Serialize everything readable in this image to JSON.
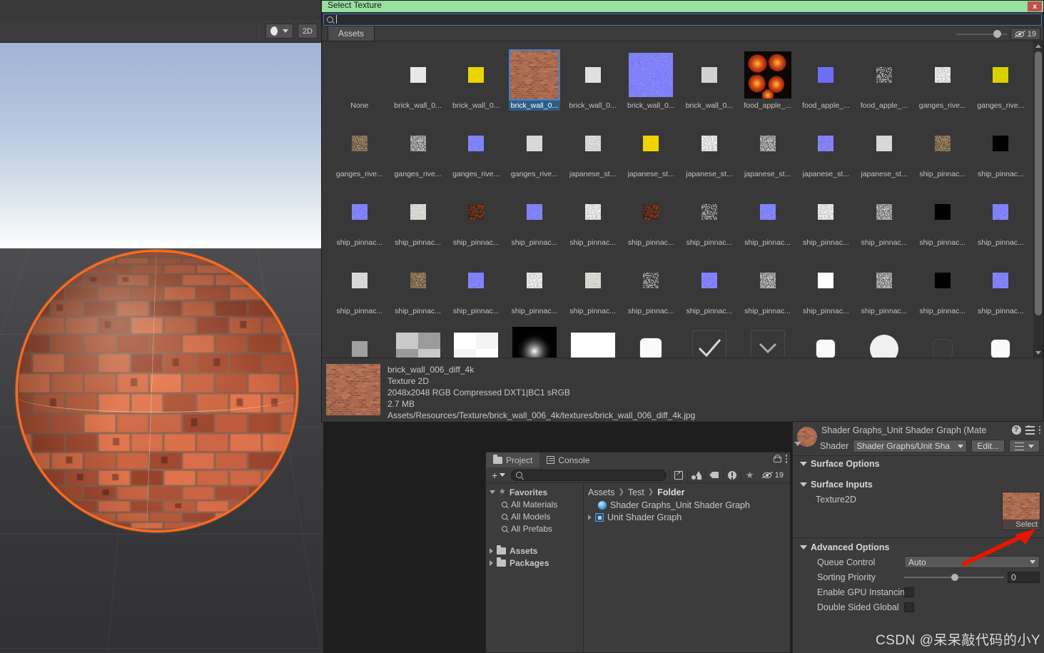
{
  "scene_view": {
    "toolbar": {
      "lighting_icon": "lit-sphere-icon",
      "lighting_dropdown_icon": "chevron-down-icon",
      "twod_label": "2D"
    },
    "selection_outline_color": "#ff6d1f",
    "object": "brick-textured-sphere"
  },
  "select_texture_window": {
    "title": "Select Texture",
    "close_label": "x",
    "search": {
      "value": "",
      "placeholder": "",
      "icon": "search-icon"
    },
    "tab": "Assets",
    "zoom_slider_value": 72,
    "hidden_count": "19",
    "hidden_icon": "eye-off-icon",
    "grid": [
      {
        "label": "None",
        "kind": "none"
      },
      {
        "label": "brick_wall_0...",
        "kind": "flat",
        "color": "#e8e8e8",
        "size": 22
      },
      {
        "label": "brick_wall_0...",
        "kind": "flat",
        "color": "#e8d600",
        "size": 22
      },
      {
        "label": "brick_wall_0...",
        "kind": "brick",
        "size": 68,
        "selected": true
      },
      {
        "label": "brick_wall_0...",
        "kind": "flat",
        "color": "#e0e0e0",
        "size": 22
      },
      {
        "label": "brick_wall_0...",
        "kind": "normal",
        "size": 62
      },
      {
        "label": "brick_wall_0...",
        "kind": "flat",
        "color": "#d2d2d2",
        "size": 22
      },
      {
        "label": "food_apple_...",
        "kind": "apple",
        "size": 66
      },
      {
        "label": "food_apple_...",
        "kind": "flat",
        "color": "#6e6ef5",
        "size": 22
      },
      {
        "label": "food_apple_...",
        "kind": "noise-dark",
        "size": 22
      },
      {
        "label": "ganges_rive...",
        "kind": "noise-light",
        "size": 22
      },
      {
        "label": "ganges_rive...",
        "kind": "flat",
        "color": "#d8d200",
        "size": 22
      },
      {
        "label": "ganges_rive...",
        "kind": "dirt",
        "size": 22
      },
      {
        "label": "ganges_rive...",
        "kind": "gravel",
        "size": 22
      },
      {
        "label": "ganges_rive...",
        "kind": "normal",
        "size": 22
      },
      {
        "label": "ganges_rive...",
        "kind": "flat",
        "color": "#d8d8d8",
        "size": 22
      },
      {
        "label": "japanese_st...",
        "kind": "stonewall",
        "size": 22
      },
      {
        "label": "japanese_st...",
        "kind": "flat",
        "color": "#f0d400",
        "size": 22
      },
      {
        "label": "japanese_st...",
        "kind": "noise-light",
        "size": 22
      },
      {
        "label": "japanese_st...",
        "kind": "gravel",
        "size": 22
      },
      {
        "label": "japanese_st...",
        "kind": "normal",
        "size": 22
      },
      {
        "label": "japanese_st...",
        "kind": "flat",
        "color": "#d8d8d8",
        "size": 22
      },
      {
        "label": "ship_pinnac...",
        "kind": "dirt",
        "size": 22
      },
      {
        "label": "ship_pinnac...",
        "kind": "flat",
        "color": "#000000",
        "size": 22
      },
      {
        "label": "ship_pinnac...",
        "kind": "normal",
        "size": 22
      },
      {
        "label": "ship_pinnac...",
        "kind": "stonewall",
        "size": 22
      },
      {
        "label": "ship_pinnac...",
        "kind": "rust",
        "size": 22
      },
      {
        "label": "ship_pinnac...",
        "kind": "normal",
        "size": 22
      },
      {
        "label": "ship_pinnac...",
        "kind": "noise-light",
        "size": 22
      },
      {
        "label": "ship_pinnac...",
        "kind": "rust",
        "size": 22
      },
      {
        "label": "ship_pinnac...",
        "kind": "noise-dark",
        "size": 22
      },
      {
        "label": "ship_pinnac...",
        "kind": "normal",
        "size": 22
      },
      {
        "label": "ship_pinnac...",
        "kind": "noise-light",
        "size": 22
      },
      {
        "label": "ship_pinnac...",
        "kind": "gravel",
        "size": 22
      },
      {
        "label": "ship_pinnac...",
        "kind": "flat",
        "color": "#000000",
        "size": 22
      },
      {
        "label": "ship_pinnac...",
        "kind": "normal",
        "size": 22
      },
      {
        "label": "ship_pinnac...",
        "kind": "flat",
        "color": "#d8d8d8",
        "size": 22
      },
      {
        "label": "ship_pinnac...",
        "kind": "dirt",
        "size": 22
      },
      {
        "label": "ship_pinnac...",
        "kind": "normal",
        "size": 22
      },
      {
        "label": "ship_pinnac...",
        "kind": "noise-light",
        "size": 22
      },
      {
        "label": "ship_pinnac...",
        "kind": "stonewall",
        "size": 22
      },
      {
        "label": "ship_pinnac...",
        "kind": "noise-dark",
        "size": 22
      },
      {
        "label": "ship_pinnac...",
        "kind": "normal",
        "size": 22
      },
      {
        "label": "ship_pinnac...",
        "kind": "gravel",
        "size": 22
      },
      {
        "label": "ship_pinnac...",
        "kind": "flat",
        "color": "#ffffff",
        "size": 22
      },
      {
        "label": "ship_pinnac...",
        "kind": "gravel",
        "size": 22
      },
      {
        "label": "ship_pinnac...",
        "kind": "flat",
        "color": "#000000",
        "size": 22
      },
      {
        "label": "ship_pinnac...",
        "kind": "normal",
        "size": 22
      },
      {
        "label": "",
        "kind": "flat",
        "color": "#a0a0a0",
        "size": 22
      },
      {
        "label": "",
        "kind": "checker",
        "size": 62
      },
      {
        "label": "",
        "kind": "checker-light",
        "size": 62
      },
      {
        "label": "",
        "kind": "radial",
        "size": 62
      },
      {
        "label": "",
        "kind": "flat",
        "color": "#ffffff",
        "size": 62
      },
      {
        "label": "",
        "kind": "rounded-sq",
        "size": 30
      },
      {
        "label": "",
        "kind": "check-mark",
        "size": 46
      },
      {
        "label": "",
        "kind": "chevron-down",
        "size": 46
      },
      {
        "label": "",
        "kind": "rounded-sq",
        "size": 26
      },
      {
        "label": "",
        "kind": "circle",
        "size": 40
      },
      {
        "label": "",
        "kind": "rounded-sq-dark",
        "size": 26
      },
      {
        "label": "",
        "kind": "rounded-sq",
        "size": 26
      }
    ],
    "details": {
      "name": "brick_wall_006_diff_4k",
      "type": "Texture 2D",
      "format": "2048x2048  RGB Compressed DXT1|BC1 sRGB",
      "size": "2.7 MB",
      "path": "Assets/Resources/Texture/brick_wall_006_4k/textures/brick_wall_006_diff_4k.jpg"
    }
  },
  "project_panel": {
    "tabs": [
      {
        "label": "Project",
        "icon": "folder-icon",
        "active": true
      },
      {
        "label": "Console",
        "icon": "console-icon",
        "active": false
      }
    ],
    "lock_icon": "lock-icon",
    "menu_icon": "kebab-menu-icon",
    "toolbar": {
      "add_label": "+",
      "add_caret": "chevron-down-icon",
      "search": {
        "value": "",
        "placeholder": "",
        "icon": "search-icon"
      },
      "icons": [
        "save-search-icon",
        "filter-by-type-icon",
        "filter-by-label-icon",
        "filter-warning-icon",
        "favorite-star-icon"
      ],
      "hidden_count": "19"
    },
    "favorites": {
      "title": "Favorites",
      "items": [
        "All Materials",
        "All Models",
        "All Prefabs"
      ]
    },
    "folders": [
      "Assets",
      "Packages"
    ],
    "breadcrumb": [
      "Assets",
      "Test",
      "Folder"
    ],
    "items": [
      {
        "label": "Shader Graphs_Unit Shader Graph",
        "icon": "material-icon"
      },
      {
        "label": "Unit Shader Graph",
        "icon": "shader-graph-icon"
      }
    ]
  },
  "inspector": {
    "title": "Shader Graphs_Unit Shader Graph (Mate",
    "help_icon": "help-icon",
    "preset_icon": "preset-icon",
    "menu_icon": "kebab-menu-icon",
    "shader_label": "Shader",
    "shader_value": "Shader Graphs/Unit Sha",
    "edit_button": "Edit...",
    "list_button_icon": "list-icon",
    "sections": {
      "surface_options": "Surface Options",
      "surface_inputs": "Surface Inputs",
      "advanced_options": "Advanced Options"
    },
    "texture2d_label": "Texture2D",
    "texture2d_select_label": "Select",
    "advanced": {
      "queue_control_label": "Queue Control",
      "queue_control_value": "Auto",
      "sorting_priority_label": "Sorting Priority",
      "sorting_priority_value": "0",
      "gpu_instancing_label": "Enable GPU Instancin",
      "double_sided_label": "Double Sided Global "
    }
  },
  "watermark": "CSDN @呆呆敲代码的小Y"
}
